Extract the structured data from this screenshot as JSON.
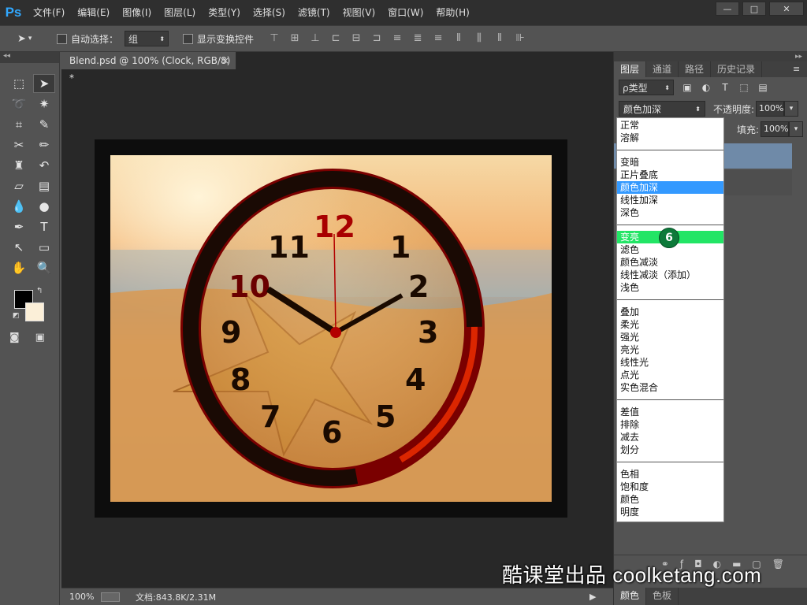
{
  "app": {
    "logo": "Ps"
  },
  "menubar": {
    "items": [
      "文件(F)",
      "编辑(E)",
      "图像(I)",
      "图层(L)",
      "类型(Y)",
      "选择(S)",
      "滤镜(T)",
      "视图(V)",
      "窗口(W)",
      "帮助(H)"
    ]
  },
  "window_controls": {
    "minimize": "—",
    "maximize": "□",
    "close": "✕"
  },
  "options": {
    "auto_select_label": "自动选择：",
    "auto_select_value": "组",
    "show_transform_label": "显示变换控件"
  },
  "document": {
    "tab_title": "Blend.psd @ 100% (Clock, RGB/8) *",
    "tab_close": "×"
  },
  "clock": {
    "numbers": [
      "12",
      "1",
      "2",
      "3",
      "4",
      "5",
      "6",
      "7",
      "8",
      "9",
      "10",
      "11"
    ]
  },
  "status": {
    "zoom": "100%",
    "doc_info": "文档:843.8K/2.31M",
    "arrow": "▶"
  },
  "layers_panel": {
    "tabs": [
      "图层",
      "通道",
      "路径",
      "历史记录"
    ],
    "filter_kind": "ρ类型",
    "blend_mode": "颜色加深",
    "opacity_label": "不透明度:",
    "opacity_value": "100%",
    "fill_label": "填充:",
    "fill_value": "100%"
  },
  "bottom_tabs": [
    "颜色",
    "色板"
  ],
  "blend_dropdown": {
    "groups": [
      [
        "正常",
        "溶解"
      ],
      [
        "变暗",
        "正片叠底",
        "颜色加深",
        "线性加深",
        "深色"
      ],
      [
        "变亮",
        "滤色",
        "颜色减淡",
        "线性减淡（添加）",
        "浅色"
      ],
      [
        "叠加",
        "柔光",
        "强光",
        "亮光",
        "线性光",
        "点光",
        "实色混合"
      ],
      [
        "差值",
        "排除",
        "减去",
        "划分"
      ],
      [
        "色相",
        "饱和度",
        "颜色",
        "明度"
      ]
    ],
    "selected": "颜色加深",
    "hovered": "变亮"
  },
  "annotation": {
    "step_badge": "6"
  },
  "watermark": "酷课堂出品 coolketang.com",
  "colors": {
    "selection_blue": "#3399ff",
    "hover_green": "#22e565",
    "badge_green": "#0d7a3a",
    "foreground": "#000000",
    "background": "#fbefd8"
  }
}
